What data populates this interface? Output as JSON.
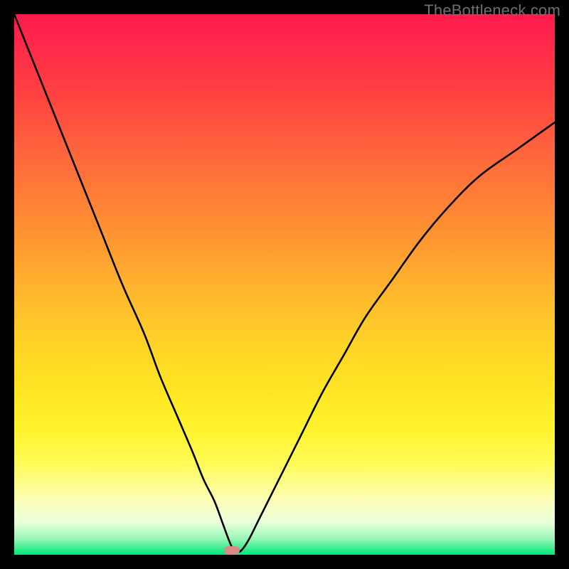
{
  "watermark": "TheBottleneck.com",
  "marker": {
    "x_frac": 0.402,
    "y_frac": 0.992
  },
  "chart_data": {
    "type": "line",
    "title": "",
    "xlabel": "",
    "ylabel": "",
    "xlim": [
      0,
      100
    ],
    "ylim": [
      0,
      100
    ],
    "series": [
      {
        "name": "curve",
        "x": [
          0,
          4,
          8,
          12,
          16,
          20,
          24,
          27,
          30,
          33,
          35,
          37,
          38.5,
          39.6,
          40.5,
          41.3,
          42.2,
          43.5,
          45,
          47,
          50,
          53,
          57,
          61,
          65,
          70,
          75,
          80,
          86,
          93,
          100
        ],
        "y": [
          100,
          90,
          80,
          70,
          60,
          50,
          41,
          33,
          26,
          19,
          14,
          10,
          6,
          3,
          1,
          0.5,
          1,
          3,
          6,
          10,
          16,
          22,
          30,
          37,
          44,
          51,
          58,
          64,
          70,
          75,
          80
        ]
      }
    ],
    "annotations": []
  }
}
